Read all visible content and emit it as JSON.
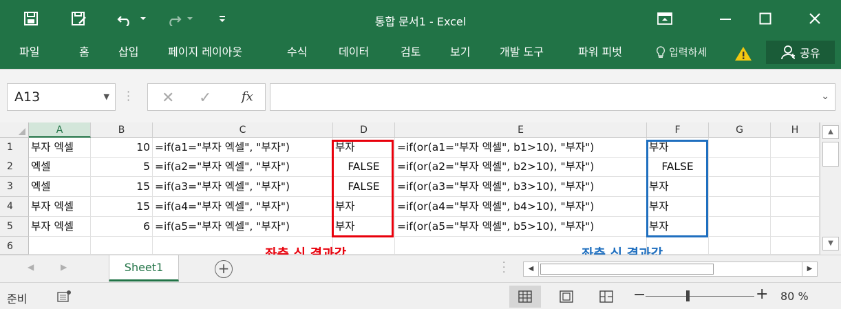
{
  "window": {
    "title": "통합 문서1 - Excel"
  },
  "icons": {
    "save": "save-icon",
    "save_as": "save-as-icon",
    "undo": "undo-icon",
    "redo": "redo-icon",
    "customize": "customize-qat-icon",
    "ribbon_display": "ribbon-display-options-icon",
    "minimize": "minimize-icon",
    "maximize": "maximize-icon",
    "close": "close-icon",
    "lightbulb": "lightbulb-icon",
    "warning": "warning-icon",
    "user": "user-icon"
  },
  "colors": {
    "brand": "#217346",
    "red_box": "#e8000b",
    "blue_box": "#1f6fbf"
  },
  "ribbon": {
    "tabs": [
      "파일",
      "홈",
      "삽입",
      "페이지 레이아웃",
      "수식",
      "데이터",
      "검토",
      "보기",
      "개발 도구",
      "파워 피벗"
    ],
    "tell_me": "입력하세",
    "share": "공유"
  },
  "formula_bar": {
    "name_box": "A13",
    "cancel": "✕",
    "enter": "✓",
    "fx": "fx",
    "content": ""
  },
  "sheet": {
    "columns": [
      "A",
      "B",
      "C",
      "D",
      "E",
      "F",
      "G",
      "H"
    ],
    "selected_column": "A",
    "rows": [
      "1",
      "2",
      "3",
      "4",
      "5",
      "6"
    ],
    "cells": [
      [
        "부자 엑셀",
        "10",
        "=if(a1=\"부자 엑셀\", \"부자\")",
        "부자",
        "=if(or(a1=\"부자 엑셀\", b1>10), \"부자\")",
        "부자",
        "",
        ""
      ],
      [
        "엑셀",
        "5",
        "=if(a2=\"부자 엑셀\", \"부자\")",
        "FALSE",
        "=if(or(a2=\"부자 엑셀\", b2>10), \"부자\")",
        "FALSE",
        "",
        ""
      ],
      [
        "엑셀",
        "15",
        "=if(a3=\"부자 엑셀\", \"부자\")",
        "FALSE",
        "=if(or(a3=\"부자 엑셀\", b3>10), \"부자\")",
        "부자",
        "",
        ""
      ],
      [
        "부자 엑셀",
        "15",
        "=if(a4=\"부자 엑셀\", \"부자\")",
        "부자",
        "=if(or(a4=\"부자 엑셀\", b4>10), \"부자\")",
        "부자",
        "",
        ""
      ],
      [
        "부자 엑셀",
        "6",
        "=if(a5=\"부자 엑셀\", \"부자\")",
        "부자",
        "=if(or(a5=\"부자 엑셀\", b5>10), \"부자\")",
        "부자",
        "",
        ""
      ],
      [
        "",
        "",
        "",
        "",
        "",
        "",
        "",
        ""
      ]
    ],
    "annotation_left": "좌측 식 결과값",
    "annotation_right": "좌측 식 결과값"
  },
  "sheet_tabs": {
    "active": "Sheet1",
    "add": "+"
  },
  "statusbar": {
    "ready": "준비",
    "zoom": "80 %",
    "zoom_level": 80
  }
}
